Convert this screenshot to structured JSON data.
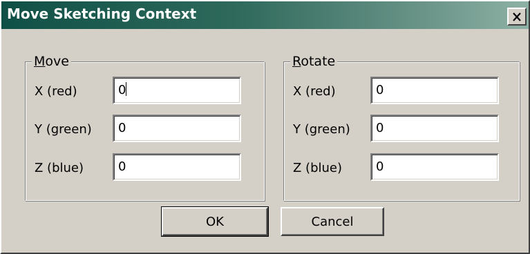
{
  "window": {
    "title": "Move Sketching Context"
  },
  "move": {
    "legend_hotkey": "M",
    "legend_rest": "ove",
    "x_label": "X (red)",
    "x_value": "0",
    "y_label": "Y (green)",
    "y_value": "0",
    "z_label": "Z (blue)",
    "z_value": "0"
  },
  "rotate": {
    "legend_hotkey": "R",
    "legend_rest": "otate",
    "x_label": "X (red)",
    "x_value": "0",
    "y_label": "Y (green)",
    "y_value": "0",
    "z_label": "Z (blue)",
    "z_value": "0"
  },
  "buttons": {
    "ok": "OK",
    "cancel": "Cancel"
  },
  "colors": {
    "dialog_face": "#d4d0c8",
    "titlebar_start": "#0f5046",
    "titlebar_end": "#8eb1a5"
  },
  "icons": {
    "close": "close-icon"
  }
}
